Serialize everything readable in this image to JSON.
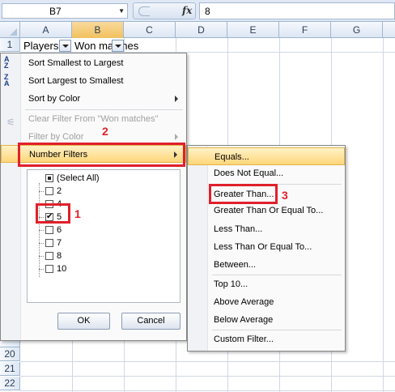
{
  "formula_bar": {
    "name_box": "B7",
    "fx_label": "fx",
    "value": "8"
  },
  "columns": [
    "A",
    "B",
    "C",
    "D",
    "E",
    "F",
    "G"
  ],
  "rows": [
    "1",
    "20",
    "21",
    "22"
  ],
  "cells": {
    "a1": "Players",
    "b1": "Won matches"
  },
  "sort_menu": {
    "sort_asc": "Sort Smallest to Largest",
    "sort_desc": "Sort Largest to Smallest",
    "sort_color": "Sort by Color",
    "clear_filter": "Clear Filter From \"Won matches\"",
    "filter_color": "Filter by Color",
    "number_filters": "Number Filters"
  },
  "checklist": [
    {
      "label": "(Select All)",
      "state": "partial"
    },
    {
      "label": "2",
      "state": "off"
    },
    {
      "label": "4",
      "state": "off"
    },
    {
      "label": "5",
      "state": "on"
    },
    {
      "label": "6",
      "state": "off"
    },
    {
      "label": "7",
      "state": "off"
    },
    {
      "label": "8",
      "state": "off"
    },
    {
      "label": "10",
      "state": "off"
    }
  ],
  "buttons": {
    "ok": "OK",
    "cancel": "Cancel"
  },
  "number_filters_submenu": [
    "Equals...",
    "Does Not Equal...",
    "Greater Than...",
    "Greater Than Or Equal To...",
    "Less Than...",
    "Less Than Or Equal To...",
    "Between...",
    "Top 10...",
    "Above Average",
    "Below Average",
    "Custom Filter..."
  ],
  "annotations": {
    "step1": "1",
    "step2": "2",
    "step3": "3"
  },
  "colors": {
    "highlight": "#ffd67a",
    "annotation": "#e0202a",
    "selected_col": "#f1c15f"
  }
}
